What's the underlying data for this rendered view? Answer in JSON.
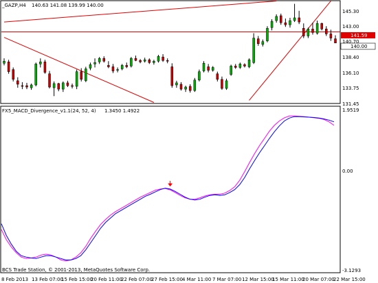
{
  "chart_title": "_GAZP,H4",
  "ohlc_readout": "140.63 141.08 139.99 140.00",
  "indicator_label": "FX5_MACD_Divergence_v1.1(24, 52, 4)",
  "indicator_values": "1.3450 1.4922",
  "copyright": "BCS Trade Station, © 2001-2013, MetaQuotes Software Corp.",
  "price_axis": {
    "ticks": [
      "145.30",
      "143.00",
      "140.70",
      "138.40",
      "136.10",
      "133.75",
      "131.45"
    ],
    "hline_label": "141.59",
    "current_label": "140.00"
  },
  "indicator_axis": {
    "ticks": [
      "1.9519",
      "0.00",
      "-3.1293"
    ]
  },
  "time_axis": {
    "ticks": [
      "8 Feb 2013",
      "13 Feb 07:00",
      "15 Feb 15:00",
      "20 Feb 11:00",
      "22 Feb 07:00",
      "27 Feb 15:00",
      "4 Mar 11:00",
      "7 Mar 07:00",
      "12 Mar 15:00",
      "15 Mar 11:00",
      "20 Mar 07:00",
      "22 Mar 15:00"
    ]
  },
  "colors": {
    "bull": "#00b000",
    "bear": "#d00000",
    "trendline": "#e00000",
    "macd_main": "#0000ff",
    "macd_signal": "#ff00ff",
    "arrow": "#ff0000"
  },
  "chart_data": {
    "type": "candlestick",
    "price_ylim": [
      131.45,
      145.95
    ],
    "horizontal_line": 141.59,
    "candles": [
      {
        "o": 137.1,
        "h": 137.8,
        "l": 136.8,
        "c": 137.4
      },
      {
        "o": 137.3,
        "h": 137.6,
        "l": 135.6,
        "c": 135.9
      },
      {
        "o": 136.2,
        "h": 136.5,
        "l": 134.5,
        "c": 134.8
      },
      {
        "o": 134.6,
        "h": 135.1,
        "l": 133.6,
        "c": 134.1
      },
      {
        "o": 133.9,
        "h": 134.4,
        "l": 133.4,
        "c": 133.8
      },
      {
        "o": 133.9,
        "h": 134.3,
        "l": 133.4,
        "c": 133.7
      },
      {
        "o": 133.6,
        "h": 134.2,
        "l": 133.3,
        "c": 134.0
      },
      {
        "o": 134.0,
        "h": 137.2,
        "l": 133.8,
        "c": 137.0
      },
      {
        "o": 137.0,
        "h": 137.8,
        "l": 136.5,
        "c": 137.3
      },
      {
        "o": 137.3,
        "h": 137.6,
        "l": 135.6,
        "c": 135.8
      },
      {
        "o": 135.6,
        "h": 136.0,
        "l": 133.5,
        "c": 133.7
      },
      {
        "o": 133.6,
        "h": 134.5,
        "l": 132.4,
        "c": 134.2
      },
      {
        "o": 134.2,
        "h": 134.3,
        "l": 133.1,
        "c": 133.4
      },
      {
        "o": 133.4,
        "h": 134.5,
        "l": 133.0,
        "c": 134.3
      },
      {
        "o": 134.3,
        "h": 134.6,
        "l": 133.7,
        "c": 133.9
      },
      {
        "o": 133.9,
        "h": 134.2,
        "l": 133.5,
        "c": 133.8
      },
      {
        "o": 133.8,
        "h": 136.2,
        "l": 133.4,
        "c": 135.9
      },
      {
        "o": 135.9,
        "h": 136.4,
        "l": 134.5,
        "c": 134.8
      },
      {
        "o": 134.6,
        "h": 136.6,
        "l": 134.4,
        "c": 136.3
      },
      {
        "o": 136.4,
        "h": 137.2,
        "l": 136.1,
        "c": 136.9
      },
      {
        "o": 137.0,
        "h": 137.8,
        "l": 136.5,
        "c": 137.2
      },
      {
        "o": 137.3,
        "h": 138.0,
        "l": 137.0,
        "c": 137.8
      },
      {
        "o": 137.8,
        "h": 138.1,
        "l": 137.2,
        "c": 137.4
      },
      {
        "o": 136.8,
        "h": 137.4,
        "l": 136.4,
        "c": 136.6
      },
      {
        "o": 136.6,
        "h": 137.0,
        "l": 135.7,
        "c": 136.0
      },
      {
        "o": 136.1,
        "h": 136.5,
        "l": 135.8,
        "c": 136.2
      },
      {
        "o": 136.3,
        "h": 137.0,
        "l": 136.1,
        "c": 136.8
      },
      {
        "o": 136.8,
        "h": 137.2,
        "l": 136.4,
        "c": 136.6
      },
      {
        "o": 136.7,
        "h": 138.0,
        "l": 136.5,
        "c": 137.8
      },
      {
        "o": 137.8,
        "h": 138.2,
        "l": 137.4,
        "c": 137.5
      },
      {
        "o": 137.5,
        "h": 137.7,
        "l": 137.1,
        "c": 137.3
      },
      {
        "o": 137.4,
        "h": 137.9,
        "l": 137.2,
        "c": 137.6
      },
      {
        "o": 137.6,
        "h": 137.8,
        "l": 137.0,
        "c": 137.2
      },
      {
        "o": 137.2,
        "h": 137.6,
        "l": 136.9,
        "c": 137.4
      },
      {
        "o": 137.4,
        "h": 138.3,
        "l": 137.2,
        "c": 138.1
      },
      {
        "o": 138.0,
        "h": 138.4,
        "l": 137.3,
        "c": 137.5
      },
      {
        "o": 137.5,
        "h": 137.8,
        "l": 137.1,
        "c": 137.4
      },
      {
        "o": 136.6,
        "h": 137.1,
        "l": 133.6,
        "c": 133.9
      },
      {
        "o": 134.0,
        "h": 134.6,
        "l": 133.6,
        "c": 134.3
      },
      {
        "o": 134.1,
        "h": 134.4,
        "l": 133.2,
        "c": 133.4
      },
      {
        "o": 133.4,
        "h": 133.9,
        "l": 133.0,
        "c": 133.7
      },
      {
        "o": 133.8,
        "h": 134.1,
        "l": 132.9,
        "c": 133.2
      },
      {
        "o": 133.2,
        "h": 135.0,
        "l": 133.0,
        "c": 134.7
      },
      {
        "o": 134.7,
        "h": 136.2,
        "l": 134.5,
        "c": 135.9
      },
      {
        "o": 136.0,
        "h": 137.4,
        "l": 135.8,
        "c": 137.1
      },
      {
        "o": 136.6,
        "h": 137.0,
        "l": 135.8,
        "c": 136.1
      },
      {
        "o": 136.1,
        "h": 136.7,
        "l": 135.9,
        "c": 136.5
      },
      {
        "o": 135.6,
        "h": 135.9,
        "l": 134.5,
        "c": 134.8
      },
      {
        "o": 134.8,
        "h": 135.2,
        "l": 133.3,
        "c": 133.5
      },
      {
        "o": 133.5,
        "h": 134.9,
        "l": 133.3,
        "c": 134.6
      },
      {
        "o": 135.5,
        "h": 136.9,
        "l": 135.3,
        "c": 136.7
      },
      {
        "o": 136.7,
        "h": 137.0,
        "l": 136.3,
        "c": 136.5
      },
      {
        "o": 136.5,
        "h": 137.2,
        "l": 136.3,
        "c": 137.0
      },
      {
        "o": 136.9,
        "h": 137.1,
        "l": 136.5,
        "c": 136.7
      },
      {
        "o": 136.6,
        "h": 137.8,
        "l": 136.4,
        "c": 137.6
      },
      {
        "o": 137.2,
        "h": 141.4,
        "l": 137.0,
        "c": 140.7
      },
      {
        "o": 140.6,
        "h": 141.0,
        "l": 139.6,
        "c": 139.9
      },
      {
        "o": 139.8,
        "h": 140.5,
        "l": 139.5,
        "c": 140.2
      },
      {
        "o": 140.3,
        "h": 142.4,
        "l": 140.1,
        "c": 142.1
      },
      {
        "o": 142.2,
        "h": 143.4,
        "l": 141.8,
        "c": 143.1
      },
      {
        "o": 143.2,
        "h": 144.1,
        "l": 142.9,
        "c": 143.8
      },
      {
        "o": 143.9,
        "h": 144.2,
        "l": 142.6,
        "c": 142.9
      },
      {
        "o": 142.9,
        "h": 143.5,
        "l": 142.3,
        "c": 142.6
      },
      {
        "o": 142.6,
        "h": 143.6,
        "l": 142.2,
        "c": 143.2
      },
      {
        "o": 143.2,
        "h": 145.6,
        "l": 143.0,
        "c": 143.6
      },
      {
        "o": 143.6,
        "h": 144.6,
        "l": 142.7,
        "c": 143.0
      },
      {
        "o": 142.1,
        "h": 142.8,
        "l": 140.7,
        "c": 141.0
      },
      {
        "o": 141.0,
        "h": 142.2,
        "l": 140.7,
        "c": 142.0
      },
      {
        "o": 142.0,
        "h": 142.9,
        "l": 141.2,
        "c": 141.5
      },
      {
        "o": 141.4,
        "h": 143.2,
        "l": 141.2,
        "c": 142.8
      },
      {
        "o": 142.8,
        "h": 142.9,
        "l": 141.8,
        "c": 142.0
      },
      {
        "o": 142.0,
        "h": 142.4,
        "l": 141.0,
        "c": 141.3
      },
      {
        "o": 141.3,
        "h": 141.9,
        "l": 140.3,
        "c": 140.7
      },
      {
        "o": 140.6,
        "h": 141.1,
        "l": 140.0,
        "c": 140.0
      }
    ],
    "trendlines": [
      {
        "from": [
          0,
          143.0
        ],
        "to": [
          60,
          146.0
        ]
      },
      {
        "from": [
          0,
          140.8
        ],
        "to": [
          33,
          131.5
        ]
      },
      {
        "from": [
          54,
          131.8
        ],
        "to": [
          72,
          146.0
        ]
      }
    ],
    "macd": {
      "ylim": [
        -3.3,
        1.9519
      ],
      "main": [
        -1.8,
        -2.2,
        -2.5,
        -2.75,
        -2.9,
        -2.95,
        -2.98,
        -3.0,
        -2.95,
        -2.9,
        -2.9,
        -2.95,
        -3.0,
        -3.05,
        -3.05,
        -3.0,
        -2.9,
        -2.7,
        -2.45,
        -2.2,
        -1.95,
        -1.75,
        -1.6,
        -1.45,
        -1.35,
        -1.25,
        -1.15,
        -1.05,
        -0.95,
        -0.85,
        -0.78,
        -0.7,
        -0.62,
        -0.57,
        -0.6,
        -0.68,
        -0.78,
        -0.88,
        -0.95,
        -0.98,
        -0.95,
        -0.88,
        -0.82,
        -0.8,
        -0.82,
        -0.8,
        -0.72,
        -0.62,
        -0.45,
        -0.2,
        0.1,
        0.38,
        0.65,
        0.9,
        1.15,
        1.38,
        1.58,
        1.75,
        1.85,
        1.9,
        1.9,
        1.89,
        1.88,
        1.87,
        1.85,
        1.82,
        1.78,
        1.72
      ],
      "signal": [
        -2.0,
        -2.35,
        -2.6,
        -2.8,
        -2.95,
        -3.0,
        -2.98,
        -2.95,
        -2.88,
        -2.85,
        -2.88,
        -2.95,
        -3.05,
        -3.08,
        -3.05,
        -2.95,
        -2.8,
        -2.58,
        -2.3,
        -2.05,
        -1.82,
        -1.65,
        -1.5,
        -1.38,
        -1.28,
        -1.18,
        -1.08,
        -0.98,
        -0.88,
        -0.8,
        -0.72,
        -0.64,
        -0.6,
        -0.58,
        -0.63,
        -0.72,
        -0.82,
        -0.9,
        -0.95,
        -0.95,
        -0.9,
        -0.84,
        -0.8,
        -0.78,
        -0.78,
        -0.74,
        -0.65,
        -0.52,
        -0.3,
        0.0,
        0.32,
        0.62,
        0.9,
        1.15,
        1.4,
        1.6,
        1.75,
        1.86,
        1.92,
        1.92,
        1.91,
        1.9,
        1.88,
        1.86,
        1.84,
        1.8,
        1.72,
        1.6
      ],
      "arrow_index": 34
    }
  }
}
